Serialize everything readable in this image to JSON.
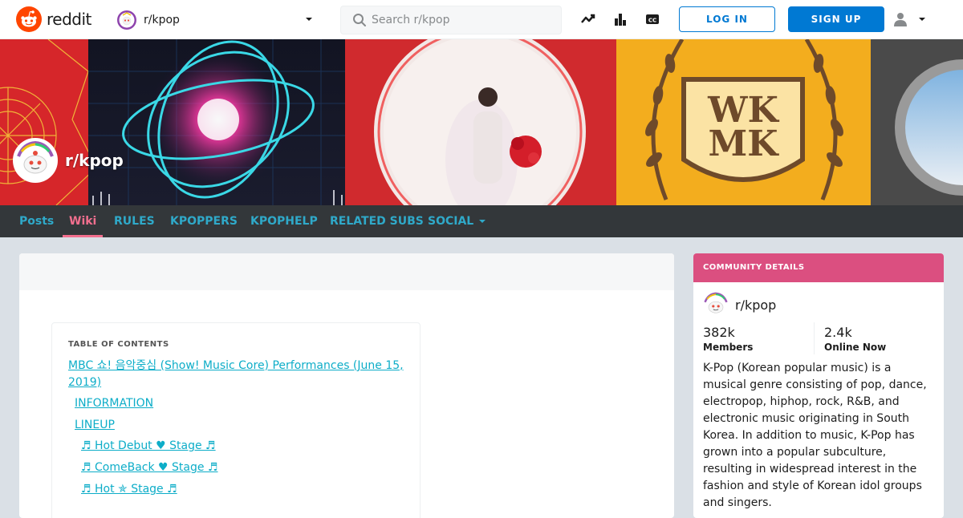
{
  "header": {
    "logo_text": "reddit",
    "community_name": "r/kpop",
    "search_placeholder": "Search r/kpop",
    "login_label": "LOG IN",
    "signup_label": "SIGN UP",
    "brand_color": "#ff4500",
    "accent_color": "#0079d3"
  },
  "banner": {
    "title": "r/kpop",
    "panel_text_line1": "WK",
    "panel_text_line2": "MK"
  },
  "nav": {
    "items": [
      {
        "label": "Posts"
      },
      {
        "label": "Wiki"
      },
      {
        "label": "RULES"
      },
      {
        "label": "KPOPPERS"
      },
      {
        "label": "KPOPHELP"
      },
      {
        "label": "RELATED SUBS"
      },
      {
        "label": "SOCIAL"
      }
    ],
    "active_color": "#f26f8e",
    "link_color": "#2fa9c9"
  },
  "toc": {
    "label": "TABLE OF CONTENTS",
    "items": [
      {
        "text": "MBC 쇼! 음악중심 (Show! Music Core) Performances (June 15,"
      },
      {
        "text": "2019)"
      },
      {
        "text": "INFORMATION"
      },
      {
        "text": "LINEUP"
      },
      {
        "text": "♬ Hot Debut ♥ Stage ♬"
      },
      {
        "text": "♬ ComeBack ♥ Stage ♬"
      },
      {
        "text": "♬ Hot ✯ Stage ♬"
      }
    ]
  },
  "sidebar": {
    "header": "COMMUNITY DETAILS",
    "community_name": "r/kpop",
    "members_count": "382k",
    "members_label": "Members",
    "online_count": "2.4k",
    "online_label": "Online Now",
    "description": "K-Pop (Korean popular music) is a musical genre consisting of pop, dance, electropop, hiphop, rock, R&B, and electronic music originating in South Korea. In addition to music, K-Pop has grown into a popular subculture, resulting in widespread interest in the fashion and style of Korean idol groups and singers.",
    "header_color": "#db4f80"
  }
}
